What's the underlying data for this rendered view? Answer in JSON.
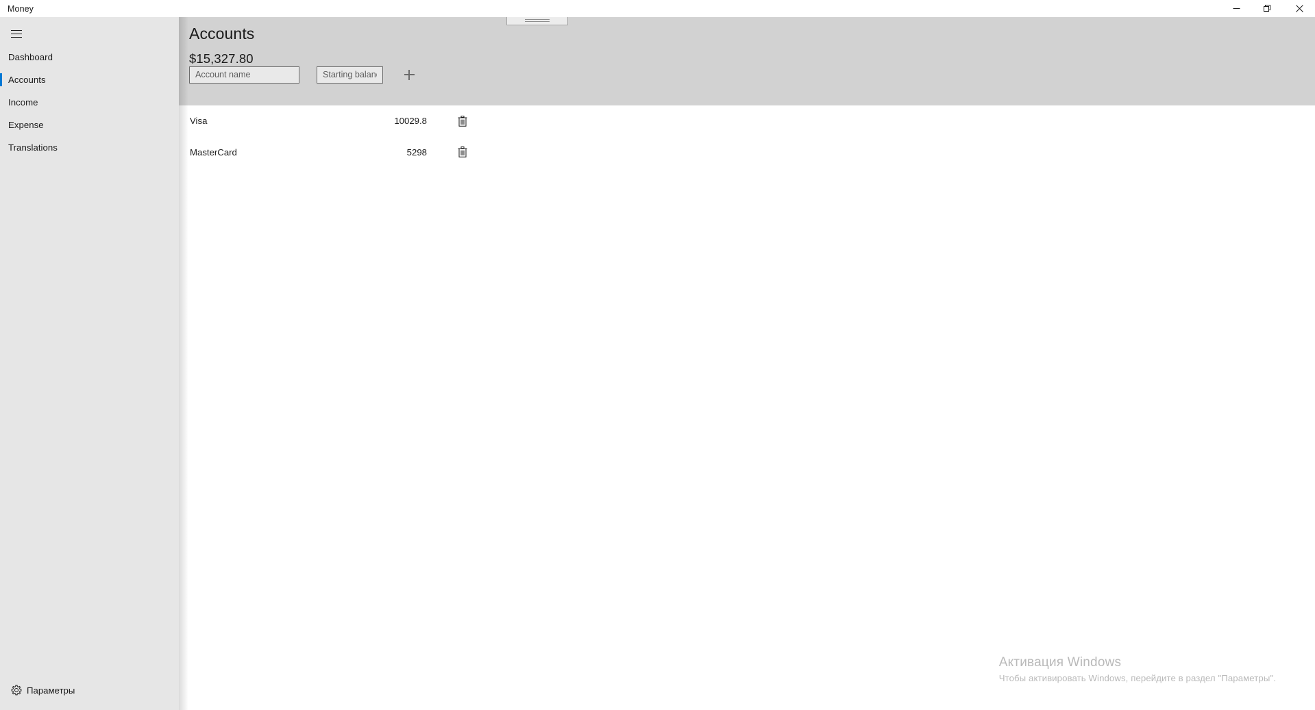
{
  "window": {
    "app_title": "Money",
    "controls": {
      "minimize_label": "Minimize",
      "maximize_label": "Restore",
      "close_label": "Close"
    }
  },
  "sidebar": {
    "menu_icon": "hamburger-icon",
    "items": [
      {
        "label": "Dashboard",
        "selected": false
      },
      {
        "label": "Accounts",
        "selected": true
      },
      {
        "label": "Income",
        "selected": false
      },
      {
        "label": "Expense",
        "selected": false
      },
      {
        "label": "Translations",
        "selected": false
      }
    ],
    "settings": {
      "label": "Параметры",
      "icon": "gear-icon"
    },
    "accent_color": "#0078d4"
  },
  "main": {
    "page_title": "Accounts",
    "total_balance": "$15,327.80",
    "form": {
      "account_name_placeholder": "Account name",
      "account_name_value": "",
      "starting_balance_placeholder": "Starting balance",
      "starting_balance_value": "",
      "add_icon": "plus-icon"
    },
    "accounts": [
      {
        "name": "Visa",
        "balance": "10029.8",
        "delete_icon": "trash-icon"
      },
      {
        "name": "MasterCard",
        "balance": "5298",
        "delete_icon": "trash-icon"
      }
    ]
  },
  "watermark": {
    "title": "Активация Windows",
    "subtitle": "Чтобы активировать Windows, перейдите в раздел \"Параметры\"."
  }
}
